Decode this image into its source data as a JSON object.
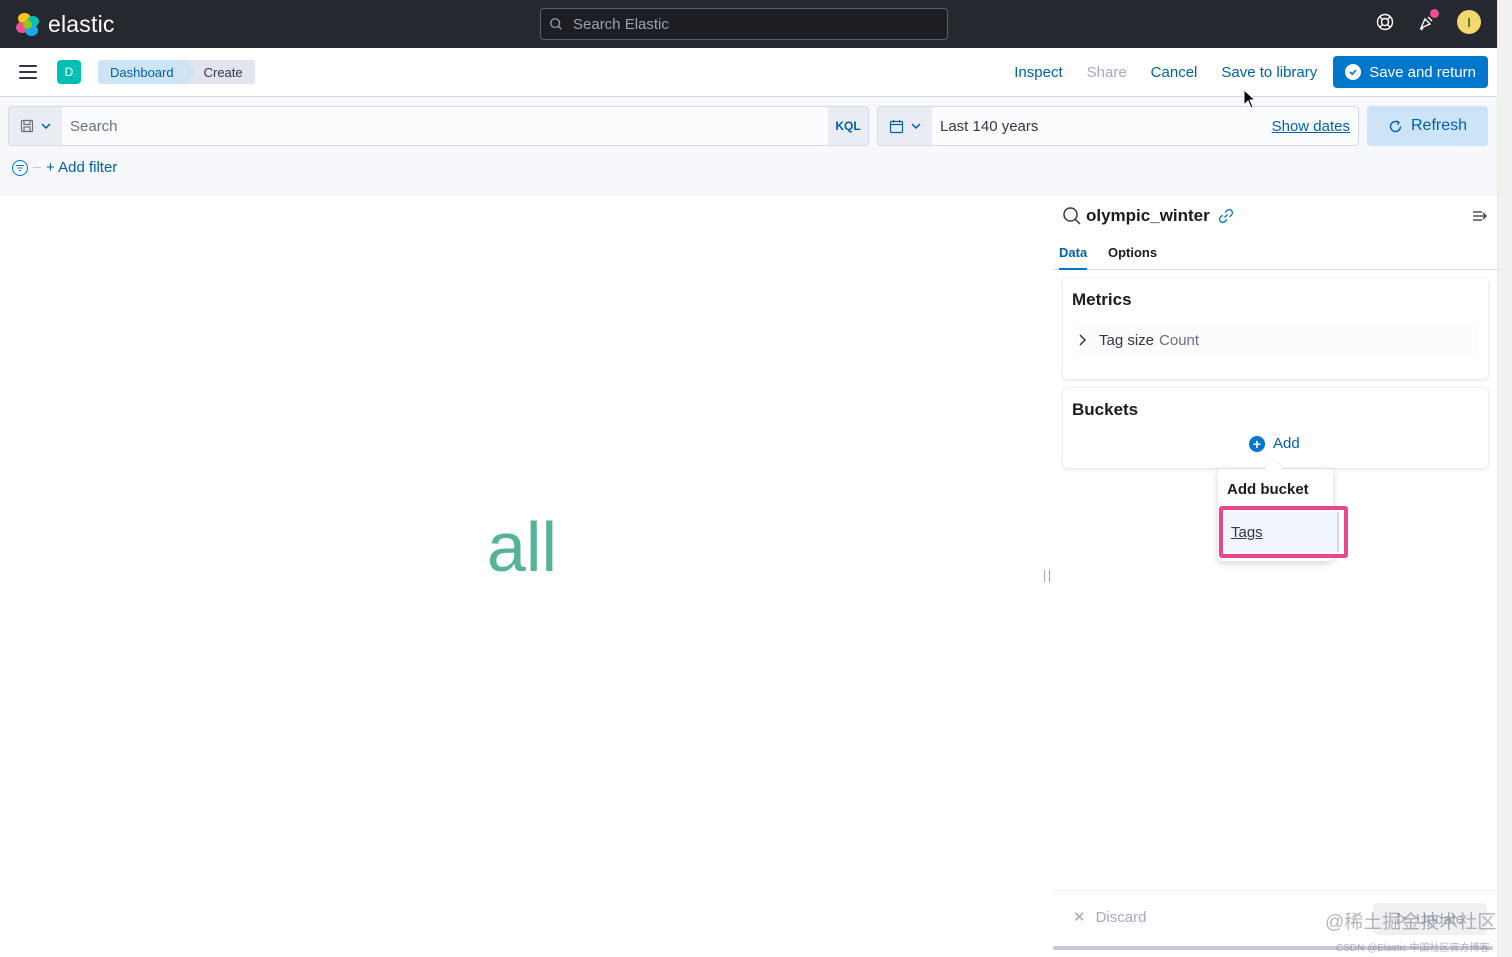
{
  "header": {
    "brand": "elastic",
    "search_placeholder": "Search Elastic",
    "avatar_initial": "I"
  },
  "appbar": {
    "space_initial": "D",
    "breadcrumbs": [
      "Dashboard",
      "Create"
    ],
    "actions": {
      "inspect": "Inspect",
      "share": "Share",
      "cancel": "Cancel",
      "save_to_library": "Save to library",
      "save_and_return": "Save and return"
    }
  },
  "querybar": {
    "search_placeholder": "Search",
    "language": "KQL",
    "date_range": "Last 140 years",
    "show_dates": "Show dates",
    "refresh": "Refresh",
    "add_filter": "+ Add filter"
  },
  "visualization": {
    "word": "all",
    "word_color": "#54b399"
  },
  "sidebar": {
    "index_pattern": "olympic_winter",
    "tabs": [
      "Data",
      "Options"
    ],
    "metrics": {
      "title": "Metrics",
      "item_label": "Tag size",
      "item_sub": "Count"
    },
    "buckets": {
      "title": "Buckets",
      "add_label": "Add"
    },
    "popover": {
      "title": "Add bucket",
      "option": "Tags"
    },
    "footer": {
      "discard": "Discard",
      "update": "Update"
    }
  },
  "watermark": {
    "line1": "@稀土掘金技术社区",
    "line2": "CSDN @Elastic 中国社区官方博客"
  },
  "colors": {
    "accent": "#0077cc",
    "highlight": "#e8488b"
  }
}
